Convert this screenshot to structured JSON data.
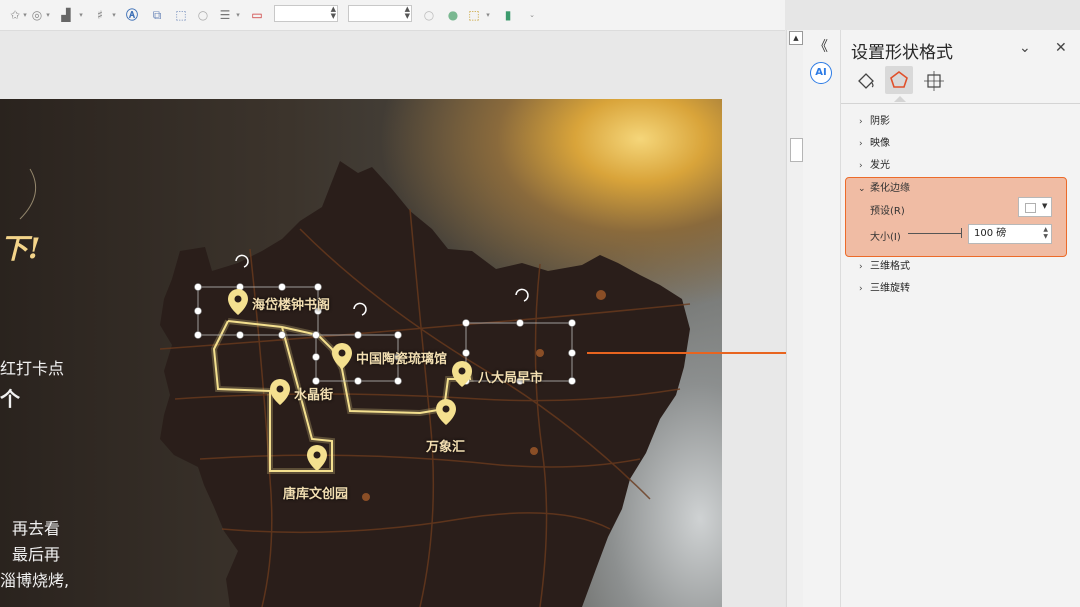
{
  "toolbar": {
    "icons": [
      "star-icon",
      "shapes-icon",
      "align-icon",
      "crop-icon",
      "text-direction-icon",
      "bring-forward-icon",
      "group-icon",
      "circle-outline-icon",
      "line-spacing-icon",
      "red-marker-icon",
      "fill-circle-icon",
      "green-circle-icon",
      "cursor-icon",
      "bar-icon",
      "more-icon"
    ],
    "width_input": "",
    "height_input": ""
  },
  "slide": {
    "left_text": {
      "exclaim": "下!",
      "line1": "红打卡点",
      "line2": "个",
      "line3": "再去看",
      "line4": "最后再",
      "line5": "淄博烧烤,"
    },
    "map_labels": {
      "haidai": "海岱楼钟书阁",
      "taoci": "中国陶瓷琉璃馆",
      "badaju": "八大局早市",
      "shuijing": "水晶街",
      "wanxiang": "万象汇",
      "tangku": "唐库文创园"
    },
    "colors": {
      "map_fill": "#2a1e1a",
      "route": "#f4e08f",
      "road": "#6a3a1d"
    }
  },
  "panel": {
    "title": "设置形状格式",
    "tabs": [
      "fill-icon",
      "pentagon-effects-icon",
      "size-layout-icon"
    ],
    "sections": {
      "shadow": "阴影",
      "reflection": "映像",
      "glow": "发光",
      "soft_edges": "柔化边缘",
      "format_3d": "三维格式",
      "rotation_3d": "三维旋转"
    },
    "soft_edges": {
      "preset_label": "预设(R)",
      "size_label": "大小(I)",
      "size_value": "100 磅"
    },
    "accent": "#ec6b2a"
  },
  "rail": {
    "collapse": "《",
    "ai_badge": "AI"
  }
}
